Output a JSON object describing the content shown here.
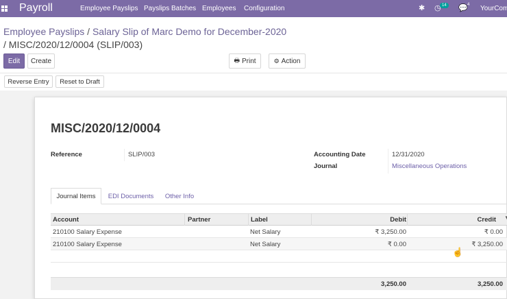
{
  "navbar": {
    "brand": "Payroll",
    "menu": [
      "Employee Payslips",
      "Payslips Batches",
      "Employees",
      "Configuration"
    ],
    "activity_count": "14",
    "message_count": "4",
    "company": "YourCom"
  },
  "breadcrumb": {
    "parent": "Employee Payslips",
    "sep": "/",
    "middle": "Salary Slip of Marc Demo for December-2020",
    "current": "/ MISC/2020/12/0004 (SLIP/003)"
  },
  "buttons": {
    "edit": "Edit",
    "create": "Create",
    "print": "Print",
    "action": "Action",
    "reverse_entry": "Reverse Entry",
    "reset_to_draft": "Reset to Draft"
  },
  "record": {
    "name": "MISC/2020/12/0004",
    "reference_label": "Reference",
    "reference_value": "SLIP/003",
    "accounting_date_label": "Accounting Date",
    "accounting_date_value": "12/31/2020",
    "journal_label": "Journal",
    "journal_value": "Miscellaneous Operations"
  },
  "tabs": [
    "Journal Items",
    "EDI Documents",
    "Other Info"
  ],
  "table": {
    "columns": [
      "Account",
      "Partner",
      "Label",
      "Debit",
      "Credit"
    ],
    "rows": [
      {
        "account": "210100 Salary Expense",
        "partner": "",
        "label": "Net Salary",
        "debit": "₹ 3,250.00",
        "credit": "₹ 0.00"
      },
      {
        "account": "210100 Salary Expense",
        "partner": "",
        "label": "Net Salary",
        "debit": "₹ 0.00",
        "credit": "₹ 3,250.00"
      }
    ],
    "total_debit": "3,250.00",
    "total_credit": "3,250.00"
  },
  "colors": {
    "brand": "#7c6ba6",
    "link": "#6c5fa8"
  }
}
